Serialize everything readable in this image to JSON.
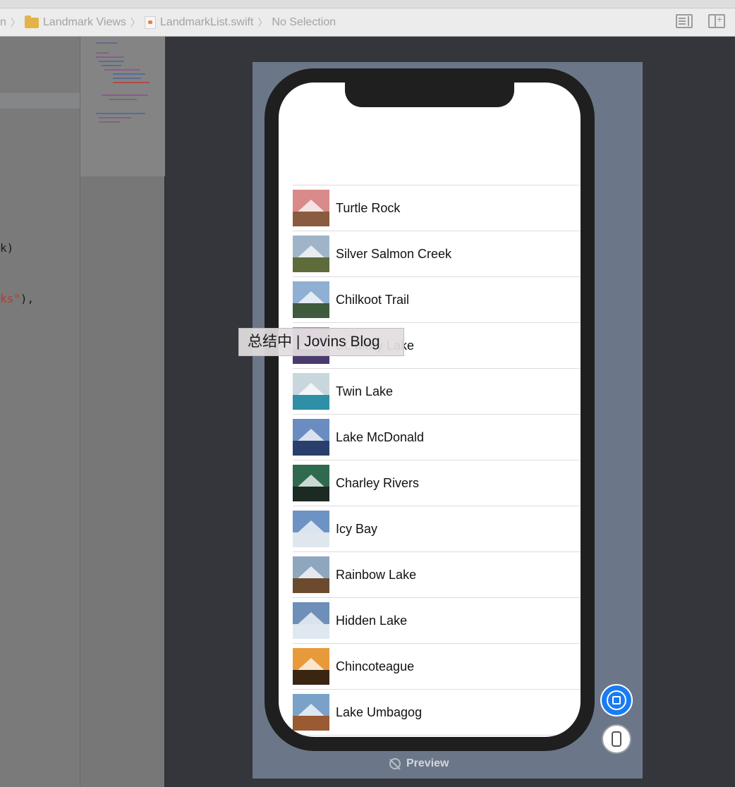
{
  "jumpbar": {
    "crumbs": [
      {
        "label": "n",
        "icon": "none"
      },
      {
        "label": "Landmark Views",
        "icon": "folder-icon"
      },
      {
        "label": "LandmarkList.swift",
        "icon": "swift-file-icon"
      },
      {
        "label": "No Selection",
        "icon": "none"
      }
    ],
    "right_icons": [
      "adjust-editor-options-icon",
      "add-editor-icon"
    ]
  },
  "editor": {
    "lines": [
      {
        "text": "k)"
      },
      {
        "str": "ks\"",
        "text": "),"
      }
    ]
  },
  "preview": {
    "label": "Preview",
    "landmarks": [
      {
        "name": "Turtle Rock",
        "sky": "#d98a8a",
        "ground": "#8a5b3e"
      },
      {
        "name": "Silver Salmon Creek",
        "sky": "#9fb4c8",
        "ground": "#5e6b3a"
      },
      {
        "name": "Chilkoot Trail",
        "sky": "#8fb0d2",
        "ground": "#3f5a3c"
      },
      {
        "name": "St. Mary Lake",
        "sky": "#b07ab8",
        "ground": "#4a3a6e"
      },
      {
        "name": "Twin Lake",
        "sky": "#c9d6de",
        "ground": "#2f8fa6"
      },
      {
        "name": "Lake McDonald",
        "sky": "#6b8cc0",
        "ground": "#2a3f6b"
      },
      {
        "name": "Charley Rivers",
        "sky": "#2f6a4e",
        "ground": "#1b2a22"
      },
      {
        "name": "Icy Bay",
        "sky": "#6c93c4",
        "ground": "#dfe6ee"
      },
      {
        "name": "Rainbow Lake",
        "sky": "#8ea7bf",
        "ground": "#6b4a2e"
      },
      {
        "name": "Hidden Lake",
        "sky": "#6d8fb8",
        "ground": "#dfe8f0"
      },
      {
        "name": "Chincoteague",
        "sky": "#e89a3a",
        "ground": "#3a2412"
      },
      {
        "name": "Lake Umbagog",
        "sky": "#7aa2c8",
        "ground": "#9a5a32"
      }
    ]
  },
  "tooltip": {
    "text": "总结中 | Jovins Blog"
  },
  "colors": {
    "accent": "#1a7cf0",
    "canvas": "#34363c",
    "device_background": "#6b7789"
  },
  "buttons": {
    "live_preview": "live-preview-button",
    "preview_on_device": "preview-on-device-button"
  }
}
